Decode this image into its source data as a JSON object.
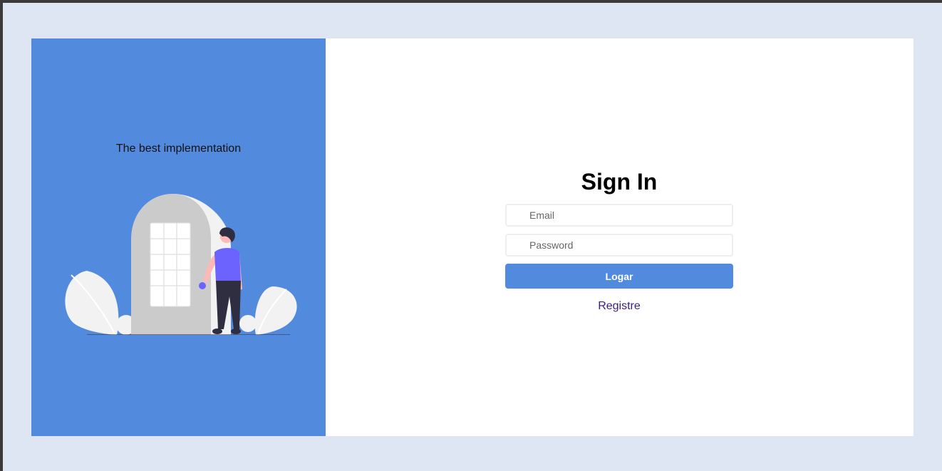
{
  "left_panel": {
    "tagline": "The best implementation",
    "illustration": "person-opening-door-illustration"
  },
  "form": {
    "title": "Sign In",
    "email": {
      "placeholder": "Email",
      "value": ""
    },
    "password": {
      "placeholder": "Password",
      "value": ""
    },
    "submit_label": "Logar",
    "register_label": "Registre"
  },
  "colors": {
    "page_background": "#dfe6f3",
    "accent": "#528add",
    "link": "#3d1b86"
  }
}
